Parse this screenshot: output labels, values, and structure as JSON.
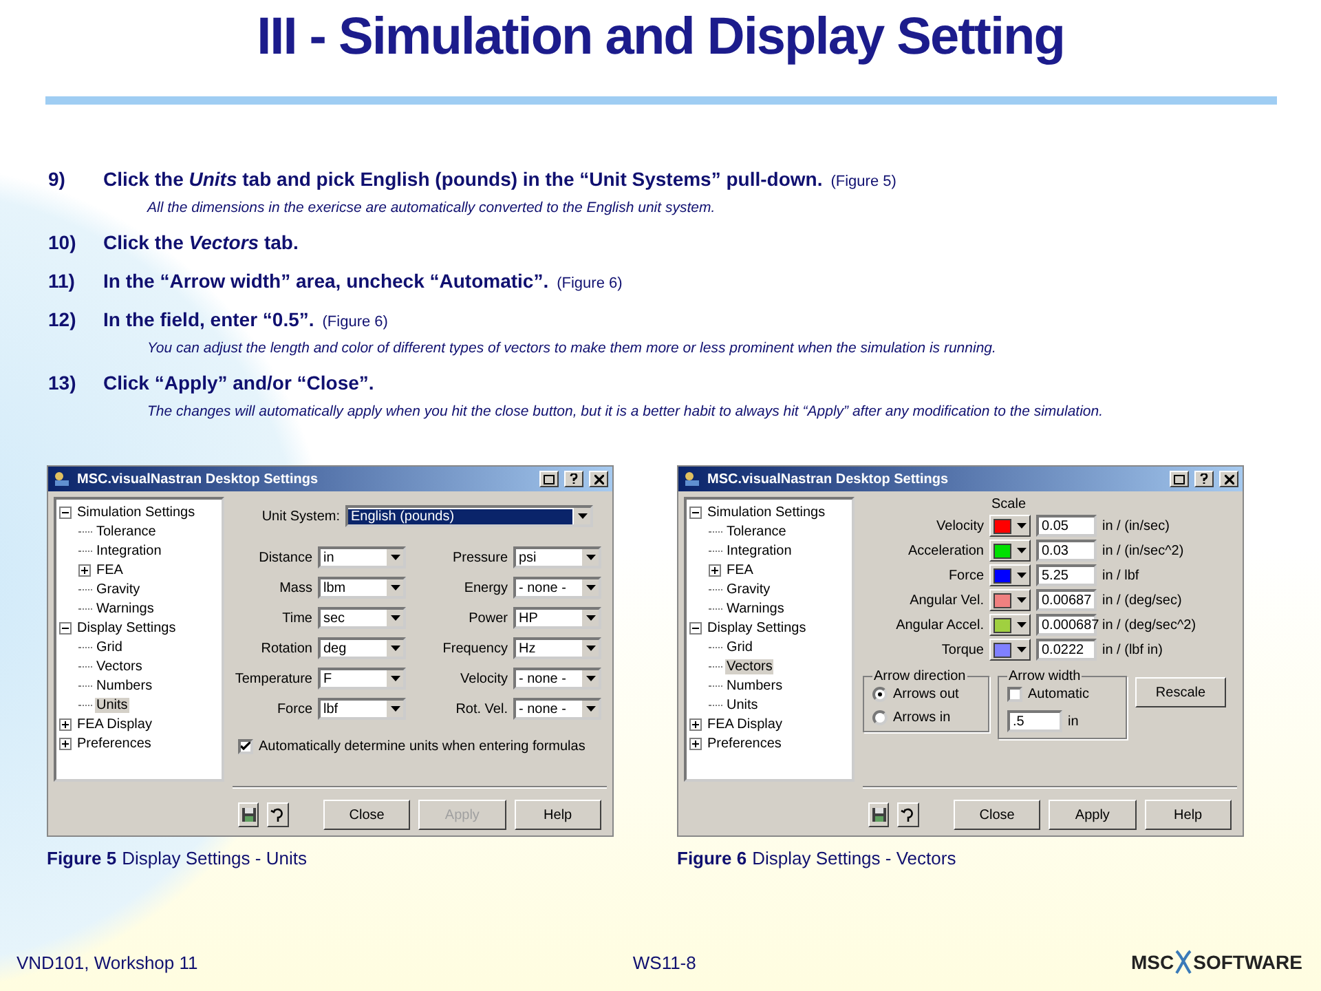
{
  "title": "III - Simulation and Display Setting",
  "steps": [
    {
      "number": "9)",
      "text": "Click the *Units* tab and pick English (pounds) in the “Unit Systems” pull-down.",
      "ref": "(Figure 5)",
      "note": "All the dimensions in the exericse are automatically converted to the English unit system."
    },
    {
      "number": "10)",
      "text": "Click the *Vectors* tab."
    },
    {
      "number": "11)",
      "text": " In the “Arrow width” area, uncheck “Automatic”.",
      "ref": "(Figure 6)"
    },
    {
      "number": "12)",
      "text": "In the field, enter “0.5”.",
      "ref": "(Figure 6)",
      "note": "You can adjust the length and color of different types of vectors to make them more or less prominent when the simulation is running."
    },
    {
      "number": "13)",
      "text": "Click “Apply” and/or “Close”.",
      "note": "The changes will automatically apply when you hit the close button, but it is a better habit to always hit “Apply” after any modification to the simulation."
    }
  ],
  "figures": [
    {
      "kind": "units",
      "window_title": "MSC.visualNastran Desktop Settings",
      "tree": [
        {
          "label": "Simulation Settings",
          "expanded": true,
          "selected": false,
          "children": [
            {
              "label": "Tolerance",
              "selected": false
            },
            {
              "label": "Integration",
              "selected": false
            },
            {
              "label": "FEA",
              "expanded": false,
              "selected": false
            },
            {
              "label": "Gravity",
              "selected": false
            },
            {
              "label": "Warnings",
              "selected": false
            }
          ]
        },
        {
          "label": "Display Settings",
          "expanded": true,
          "selected": false,
          "children": [
            {
              "label": "Grid",
              "selected": false
            },
            {
              "label": "Vectors",
              "selected": false
            },
            {
              "label": "Numbers",
              "selected": false
            },
            {
              "label": "Units",
              "selected": true
            }
          ]
        },
        {
          "label": "FEA Display",
          "expanded": false,
          "selected": false
        },
        {
          "label": "Preferences",
          "expanded": false,
          "selected": false
        }
      ],
      "unit_system": {
        "label": "Unit System:",
        "value": "English (pounds)"
      },
      "left_units": [
        {
          "label": "Distance",
          "value": "in"
        },
        {
          "label": "Mass",
          "value": "lbm"
        },
        {
          "label": "Time",
          "value": "sec"
        },
        {
          "label": "Rotation",
          "value": "deg"
        },
        {
          "label": "Temperature",
          "value": "F"
        },
        {
          "label": "Force",
          "value": "lbf"
        }
      ],
      "right_units": [
        {
          "label": "Pressure",
          "value": "psi"
        },
        {
          "label": "Energy",
          "value": "- none -"
        },
        {
          "label": "Power",
          "value": "HP"
        },
        {
          "label": "Frequency",
          "value": "Hz"
        },
        {
          "label": "Velocity",
          "value": "- none -"
        },
        {
          "label": "Rot. Vel.",
          "value": "- none -"
        }
      ],
      "auto_units": {
        "label": "Automatically determine units when entering formulas",
        "checked": true
      },
      "buttons": [
        {
          "label": "Close",
          "disabled": false
        },
        {
          "label": "Apply",
          "disabled": true
        },
        {
          "label": "Help",
          "disabled": false
        }
      ],
      "caption": {
        "number": "Figure 5",
        "text": "Display Settings - Units"
      }
    },
    {
      "kind": "vectors",
      "window_title": "MSC.visualNastran Desktop Settings",
      "tree": [
        {
          "label": "Simulation Settings",
          "expanded": true,
          "selected": false,
          "children": [
            {
              "label": "Tolerance",
              "selected": false
            },
            {
              "label": "Integration",
              "selected": false
            },
            {
              "label": "FEA",
              "expanded": false,
              "selected": false
            },
            {
              "label": "Gravity",
              "selected": false
            },
            {
              "label": "Warnings",
              "selected": false
            }
          ]
        },
        {
          "label": "Display Settings",
          "expanded": true,
          "selected": false,
          "children": [
            {
              "label": "Grid",
              "selected": false
            },
            {
              "label": "Vectors",
              "selected": true
            },
            {
              "label": "Numbers",
              "selected": false
            },
            {
              "label": "Units",
              "selected": false
            }
          ]
        },
        {
          "label": "FEA Display",
          "expanded": false,
          "selected": false
        },
        {
          "label": "Preferences",
          "expanded": false,
          "selected": false
        }
      ],
      "scale_header": "Scale",
      "vectors": [
        {
          "label": "Velocity",
          "color": "#ff0000",
          "value": "0.05",
          "unit": "in / (in/sec)"
        },
        {
          "label": "Acceleration",
          "color": "#00e000",
          "value": "0.03",
          "unit": "in / (in/sec^2)"
        },
        {
          "label": "Force",
          "color": "#0000ff",
          "value": "5.25",
          "unit": "in / lbf"
        },
        {
          "label": "Angular Vel.",
          "color": "#f08080",
          "value": "0.00687",
          "unit": "in / (deg/sec)"
        },
        {
          "label": "Angular Accel.",
          "color": "#a0d040",
          "value": "0.000687",
          "unit": "in / (deg/sec^2)"
        },
        {
          "label": "Torque",
          "color": "#8080ff",
          "value": "0.0222",
          "unit": "in / (lbf in)"
        }
      ],
      "arrow_direction": {
        "title": "Arrow direction",
        "options": [
          {
            "label": "Arrows out",
            "selected": true
          },
          {
            "label": "Arrows in",
            "selected": false
          }
        ]
      },
      "arrow_width": {
        "title": "Arrow width",
        "automatic": {
          "label": "Automatic",
          "checked": false
        },
        "value": ".5",
        "unit": "in"
      },
      "rescale": "Rescale",
      "buttons": [
        {
          "label": "Close",
          "disabled": false
        },
        {
          "label": "Apply",
          "disabled": false
        },
        {
          "label": "Help",
          "disabled": false
        }
      ],
      "caption": {
        "number": "Figure 6",
        "text": "Display Settings - Vectors"
      }
    }
  ],
  "footer": {
    "course": "VND101, Workshop 11",
    "page": "WS11-8",
    "logo_left": "MSC",
    "logo_right": "SOFTWARE"
  }
}
